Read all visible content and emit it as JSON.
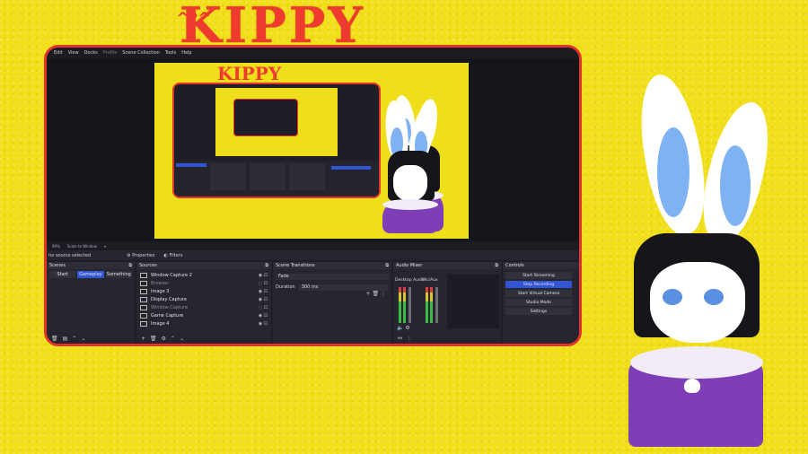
{
  "logo": {
    "text": "KIPPY",
    "mark": "^ᵠ^"
  },
  "menu": [
    "Edit",
    "View",
    "Docks",
    "Profile",
    "Scene Collection",
    "Tools",
    "Help"
  ],
  "status": {
    "zoom": "99%",
    "scale": "Scale to Window"
  },
  "source_bar": {
    "selection": "no source selected",
    "properties": "Properties",
    "filters": "Filters"
  },
  "scenes": {
    "title": "Scenes",
    "items": [
      {
        "label": "Start",
        "active": false
      },
      {
        "label": "Gameplay",
        "active": true
      },
      {
        "label": "Something",
        "active": false
      }
    ]
  },
  "sources": {
    "title": "Sources",
    "items": [
      {
        "label": "Window Capture 2",
        "dim": false
      },
      {
        "label": "Browser",
        "dim": true
      },
      {
        "label": "Image 3",
        "dim": false
      },
      {
        "label": "Display Capture",
        "dim": false
      },
      {
        "label": "Window Capture",
        "dim": true
      },
      {
        "label": "Game Capture",
        "dim": false
      },
      {
        "label": "Image 4",
        "dim": false
      }
    ]
  },
  "transitions": {
    "title": "Scene Transitions",
    "type": "Fade",
    "duration_label": "Duration",
    "duration": "300 ms"
  },
  "mixer": {
    "title": "Audio Mixer",
    "channels": [
      {
        "name": "Desktop Audio"
      },
      {
        "name": "Mic/Aux"
      }
    ]
  },
  "controls": {
    "title": "Controls",
    "buttons": [
      {
        "label": "Start Streaming",
        "active": false
      },
      {
        "label": "Stop Recording",
        "active": true
      },
      {
        "label": "Start Virtual Camera",
        "active": false
      },
      {
        "label": "Studio Mode",
        "active": false
      },
      {
        "label": "Settings",
        "active": false
      }
    ]
  },
  "colors": {
    "background": "#f0df19",
    "frame": "#e2342d",
    "accent": "#3255d6",
    "sweater": "#7e3fb6"
  }
}
